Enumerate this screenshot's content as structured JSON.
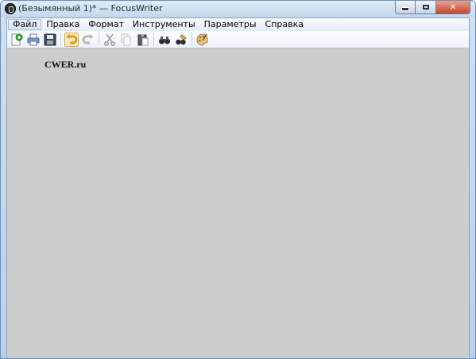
{
  "window": {
    "title": "(Безымянный 1)* — FocusWriter",
    "caption_buttons": {
      "minimize": "",
      "maximize": "",
      "close": "✕"
    }
  },
  "menu": [
    {
      "label": "Файл",
      "active": true
    },
    {
      "label": "Правка"
    },
    {
      "label": "Формат"
    },
    {
      "label": "Инструменты"
    },
    {
      "label": "Параметры"
    },
    {
      "label": "Справка"
    }
  ],
  "toolbar": {
    "icons": [
      "new-document-icon",
      "print-icon",
      "save-icon",
      "undo-icon",
      "redo-icon",
      "cut-icon",
      "copy-icon",
      "paste-icon",
      "find-icon",
      "replace-icon",
      "themes-icon"
    ]
  },
  "editor": {
    "text": "CWER.ru"
  },
  "colors": {
    "editor_background": "#cdcdcd",
    "frame": "#c3d7ee",
    "close_button": "#c6452b"
  }
}
